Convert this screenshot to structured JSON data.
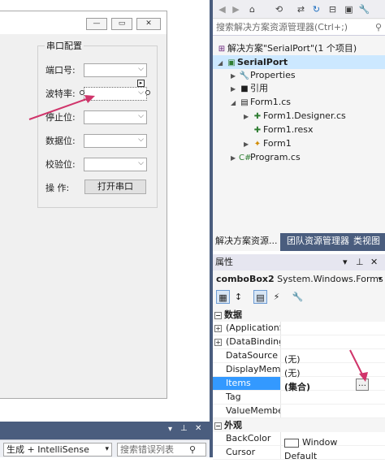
{
  "form": {
    "group_title": "串口配置",
    "fields": [
      {
        "label": "端口号:"
      },
      {
        "label": "波特率:"
      },
      {
        "label": "停止位:"
      },
      {
        "label": "数据位:"
      },
      {
        "label": "校验位:"
      }
    ],
    "action_label": "操  作:",
    "open_button": "打开串口"
  },
  "error_list": {
    "filter_combo": "生成 + IntelliSense",
    "search_placeholder": "搜索错误列表"
  },
  "solution_explorer": {
    "search_placeholder": "搜索解决方案资源管理器(Ctrl+;)",
    "tree": [
      {
        "text": "解决方案\"SerialPort\"(1 个项目)"
      },
      {
        "text": "SerialPort"
      },
      {
        "text": "Properties"
      },
      {
        "text": "引用"
      },
      {
        "text": "Form1.cs"
      },
      {
        "text": "Form1.Designer.cs"
      },
      {
        "text": "Form1.resx"
      },
      {
        "text": "Form1"
      },
      {
        "text": "Program.cs"
      }
    ],
    "tabs": [
      "解决方案资源...",
      "团队资源管理器",
      "类视图"
    ]
  },
  "properties": {
    "header": "属性",
    "object_name": "comboBox2",
    "object_type": "System.Windows.Forms",
    "categories": [
      {
        "name": "数据",
        "rows": [
          {
            "name": "(ApplicationSett",
            "value": ""
          },
          {
            "name": "(DataBindings)",
            "value": ""
          },
          {
            "name": "DataSource",
            "value": "(无)"
          },
          {
            "name": "DisplayMember",
            "value": "(无)"
          },
          {
            "name": "Items",
            "value": "(集合)"
          },
          {
            "name": "Tag",
            "value": ""
          },
          {
            "name": "ValueMember",
            "value": ""
          }
        ]
      },
      {
        "name": "外观",
        "rows": [
          {
            "name": "BackColor",
            "value": "Window"
          },
          {
            "name": "Cursor",
            "value": "Default"
          }
        ]
      }
    ]
  },
  "colors": {
    "accent_dark": "#4a5d7e",
    "selection": "#3399ff",
    "arrow": "#d0356b"
  }
}
